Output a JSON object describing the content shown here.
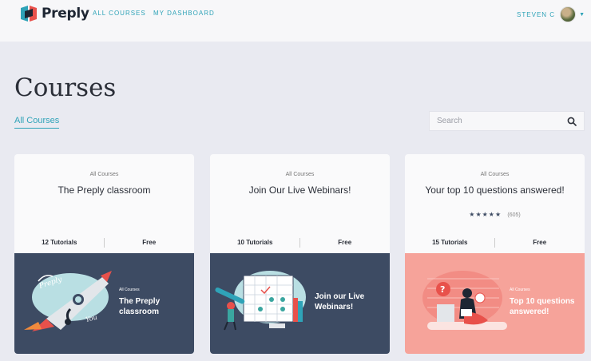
{
  "brand": {
    "name": "Preply"
  },
  "nav": {
    "all_courses": "ALL COURSES",
    "dashboard": "MY DASHBOARD"
  },
  "user": {
    "name": "STEVEN C"
  },
  "page": {
    "title": "Courses",
    "tab": "All Courses"
  },
  "search": {
    "placeholder": "Search"
  },
  "colors": {
    "accent": "#2fa3b8",
    "navy": "#3d4b63",
    "coral": "#f6a39a"
  },
  "cards": [
    {
      "category": "All Courses",
      "title": "The Preply classroom",
      "tutorials": "12 Tutorials",
      "price": "Free",
      "banner": {
        "category": "All Courses",
        "title_line1": "The Preply",
        "title_line2": "classroom"
      }
    },
    {
      "category": "All Courses",
      "title": "Join Our Live Webinars!",
      "tutorials": "10 Tutorials",
      "price": "Free",
      "banner": {
        "category": "",
        "title_line1": "Join our Live",
        "title_line2": "Webinars!"
      }
    },
    {
      "category": "All Courses",
      "title": "Your top 10 questions answered!",
      "tutorials": "15 Tutorials",
      "price": "Free",
      "rating": {
        "stars": "★★★★★",
        "count": "(605)"
      },
      "banner": {
        "category": "All Courses",
        "title_line1": "Top 10 questions",
        "title_line2": "answered!"
      }
    }
  ]
}
